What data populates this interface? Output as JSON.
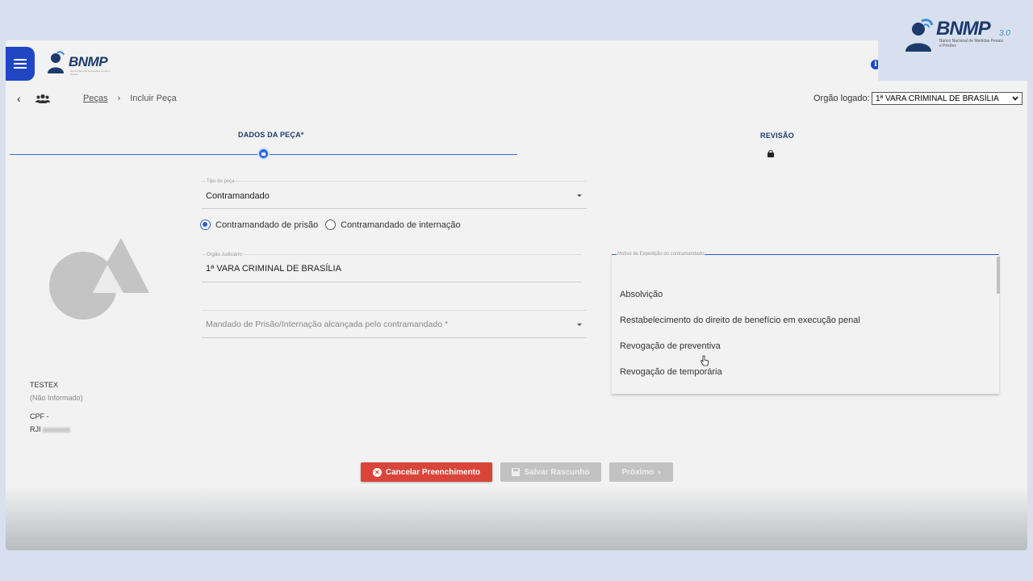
{
  "header": {
    "app_name": "BNMP",
    "app_subtitle": "Banco Nacional de Medidas Penais e Prisões",
    "badge_name": "BNMP",
    "badge_version": "3.0",
    "badge_subtitle": "Banco Nacional de Medidas Penais e Prisões",
    "menu_icon": "hamburger-icon",
    "info_icon": "info-icon",
    "accent": "#1f47c4"
  },
  "breadcrumb": {
    "link": "Peças",
    "current": "Incluir Peça"
  },
  "org": {
    "label": "Orgão logado:",
    "value": "1ª VARA CRIMINAL DE BRASÍLIA"
  },
  "steps": [
    {
      "label": "DADOS DA PEÇA*"
    },
    {
      "label": "REVISÃO"
    }
  ],
  "person": {
    "name": "TESTEX",
    "alias": "(Não Informado)",
    "cpf": "CPF -",
    "rji": "RJI"
  },
  "form": {
    "tipo_label": "Tipo de peça",
    "tipo_value": "Contramandado",
    "radio_1": "Contramandado de prisão",
    "radio_2": "Contramandado de internação",
    "orgao_label": "Orgão Judiciário",
    "orgao_value": "1ª VARA CRIMINAL DE BRASÍLIA",
    "mandado_placeholder": "Mandado de Prisão/Internação alcançada pelo contramandado *",
    "motivo_label": "Motivo de Expedição do contramandado"
  },
  "dropdown_options": [
    "Absolvição",
    "Restabelecimento do direito de benefício em execução penal",
    "Revogação de preventiva",
    "Revogação de temporária"
  ],
  "buttons": {
    "cancel": "Cancelar Preenchimento",
    "draft": "Salvar Rascunho",
    "next": "Próximo"
  }
}
